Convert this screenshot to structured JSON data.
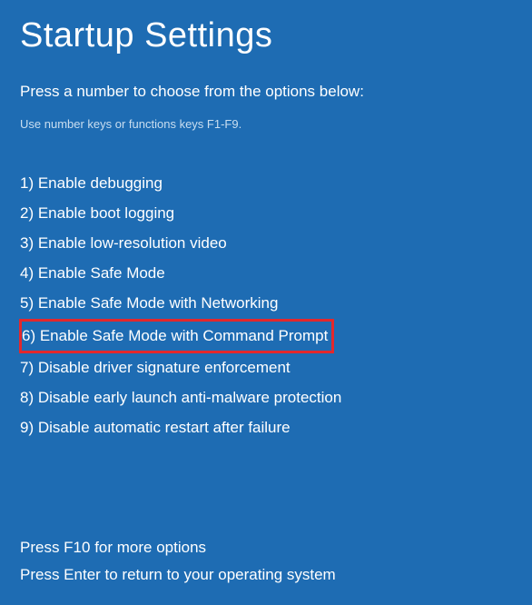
{
  "title": "Startup Settings",
  "instruction": "Press a number to choose from the options below:",
  "subInstruction": "Use number keys or functions keys F1-F9.",
  "options": [
    "1) Enable debugging",
    "2) Enable boot logging",
    "3) Enable low-resolution video",
    "4) Enable Safe Mode",
    "5) Enable Safe Mode with Networking",
    "6) Enable Safe Mode with Command Prompt",
    "7) Disable driver signature enforcement",
    "8) Disable early launch anti-malware protection",
    "9) Disable automatic restart after failure"
  ],
  "footer": {
    "moreOptions": "Press F10 for more options",
    "returnText": "Press Enter to return to your operating system"
  }
}
